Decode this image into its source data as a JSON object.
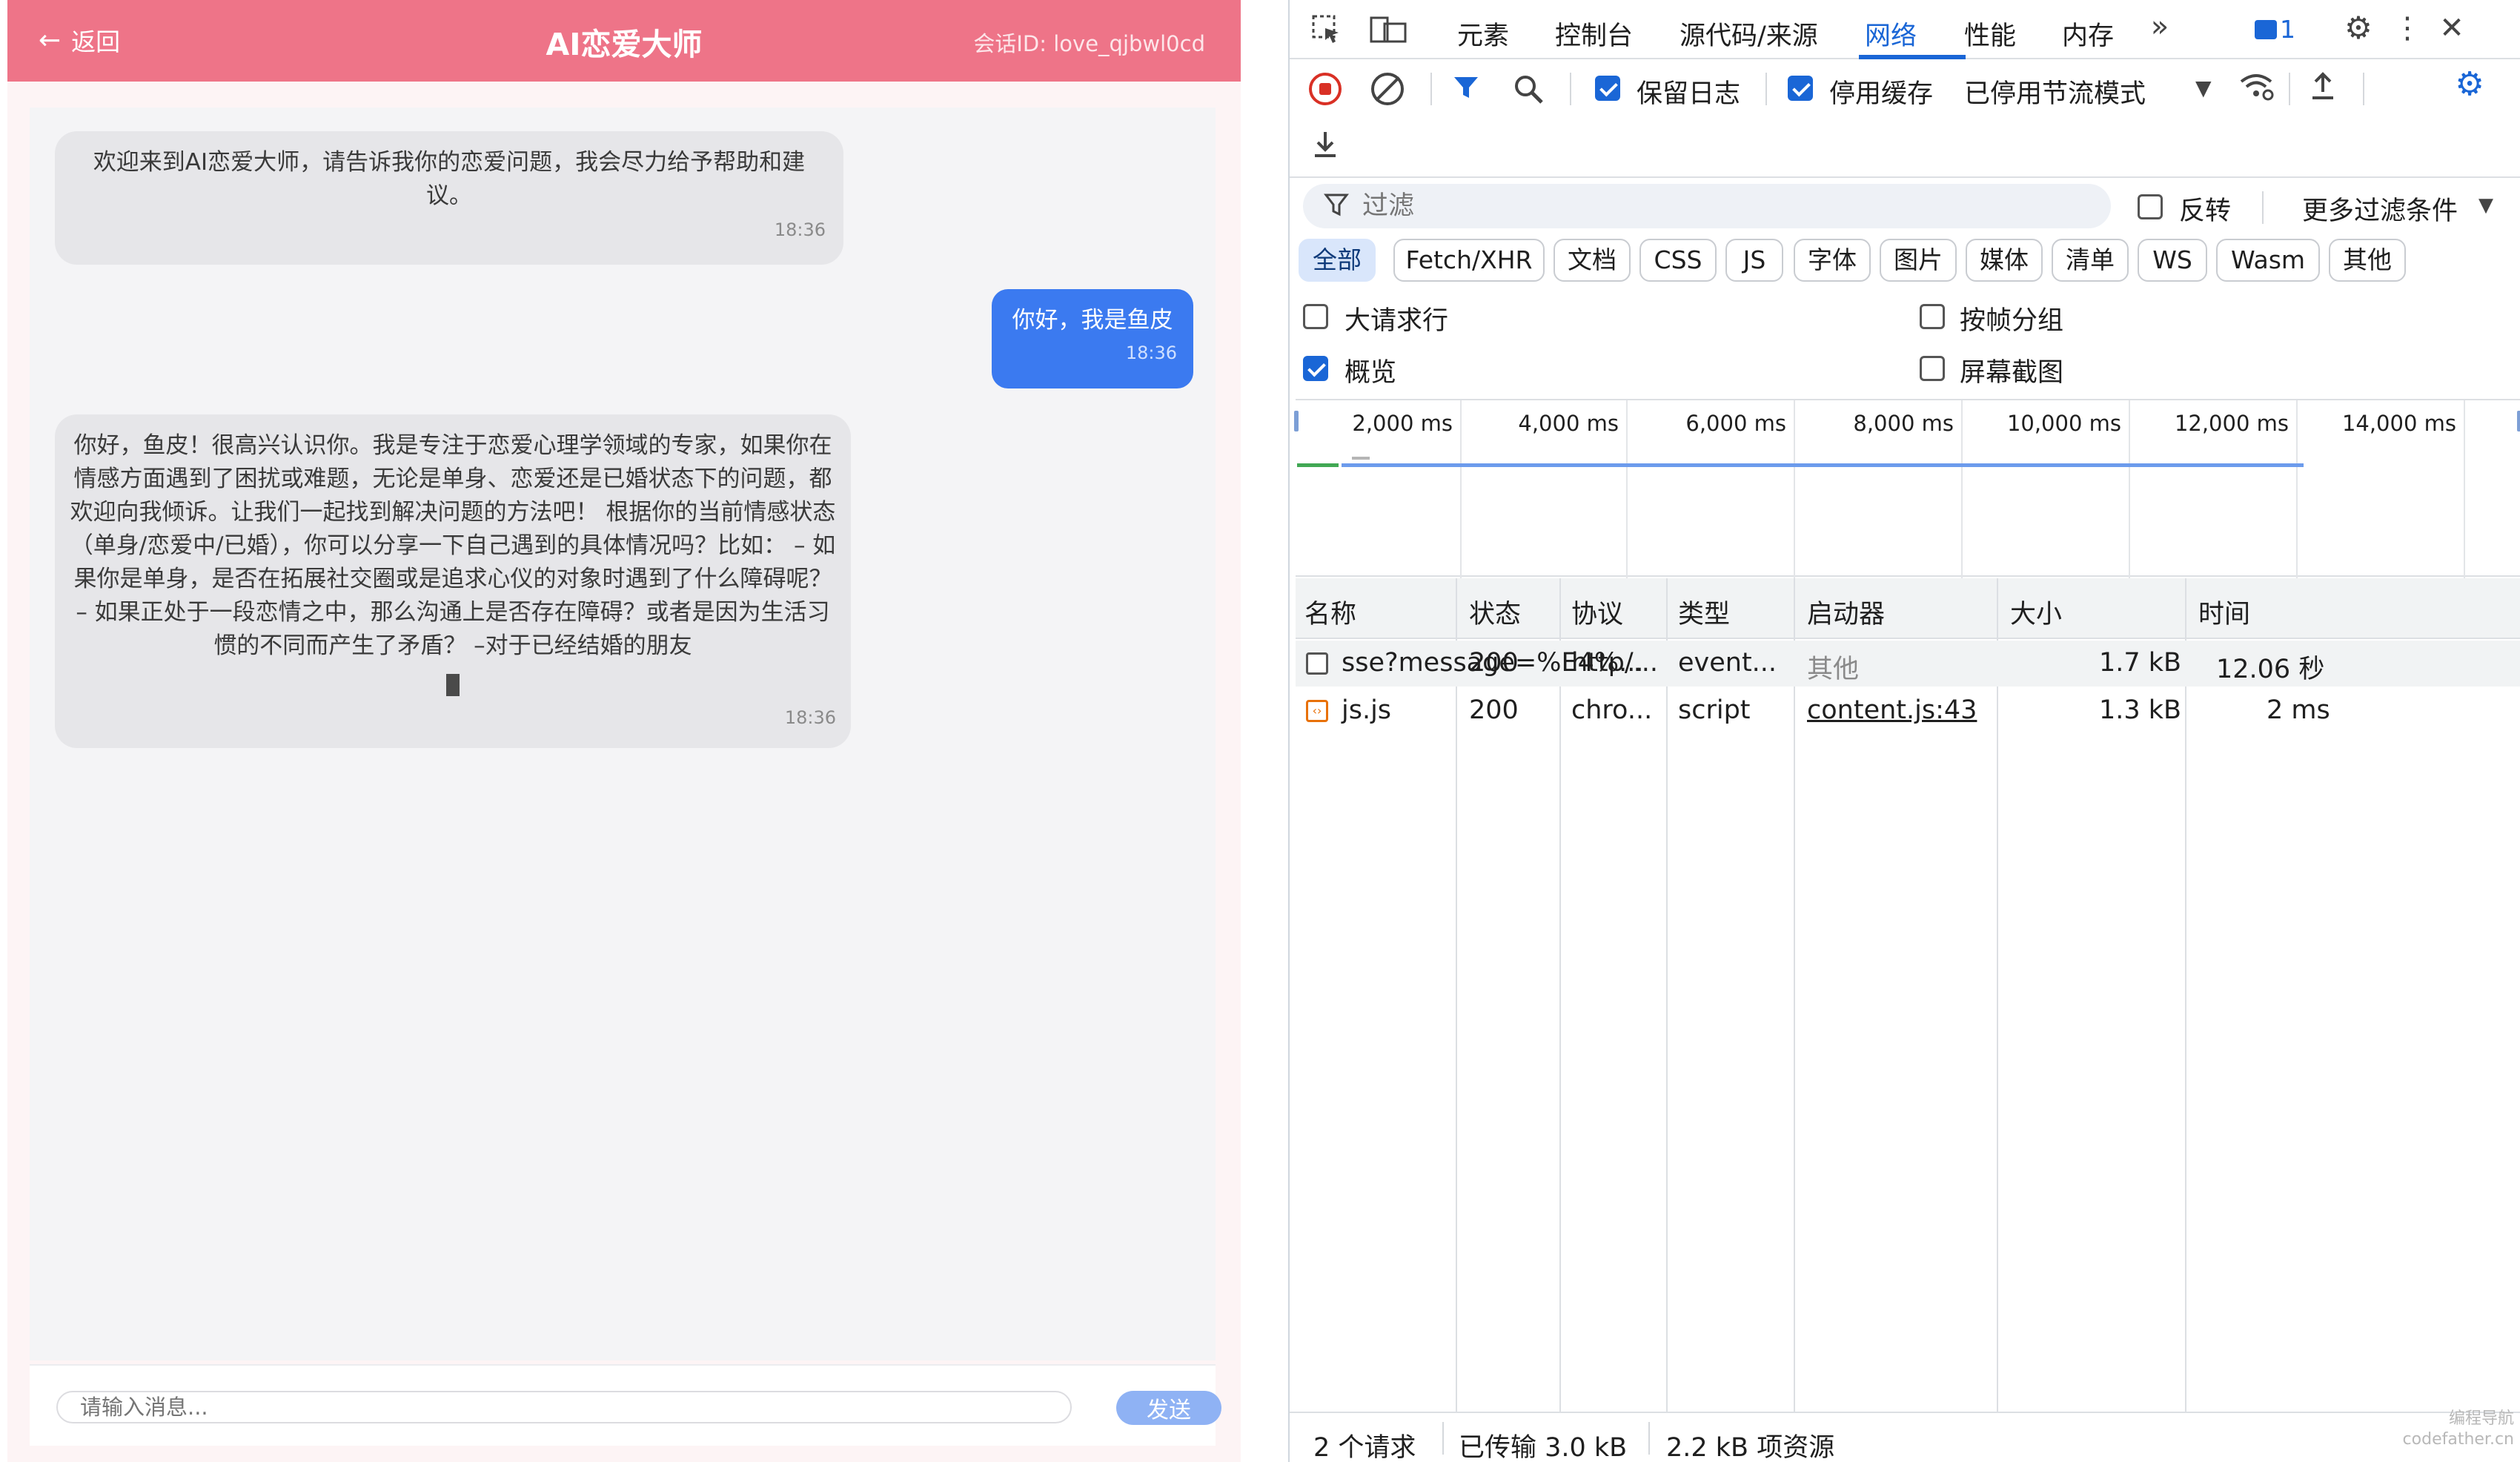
{
  "app": {
    "back_label": "返回",
    "title": "AI恋爱大师",
    "session_id": "会话ID: love_qjbwl0cd",
    "messages": [
      {
        "role": "bot",
        "text": "欢迎来到AI恋爱大师，请告诉我你的恋爱问题，我会尽力给予帮助和建议。",
        "time": "18:36"
      },
      {
        "role": "user",
        "text": "你好，我是鱼皮",
        "time": "18:36"
      },
      {
        "role": "bot",
        "text": "你好，鱼皮！很高兴认识你。我是专注于恋爱心理学领域的专家，如果你在情感方面遇到了困扰或难题，无论是单身、恋爱还是已婚状态下的问题，都欢迎向我倾诉。让我们一起找到解决问题的方法吧！ 根据你的当前情感状态（单身/恋爱中/已婚），你可以分享一下自己遇到的具体情况吗？比如： – 如果你是单身，是否在拓展社交圈或是追求心仪的对象时遇到了什么障碍呢？ – 如果正处于一段恋情之中，那么沟通上是否存在障碍？或者是因为生活习惯的不同而产生了矛盾？ –对于已经结婚的朋友",
        "time": "18:36"
      }
    ],
    "input_placeholder": "请输入消息...",
    "send_label": "发送"
  },
  "devtools": {
    "tabs": [
      "元素",
      "控制台",
      "源代码/来源",
      "网络",
      "性能",
      "内存"
    ],
    "active_tab": "网络",
    "issues_count": "1",
    "toolbar": {
      "preserve_log": "保留日志",
      "disable_cache": "停用缓存",
      "throttle": "已停用节流模式"
    },
    "filter": {
      "placeholder": "过滤",
      "invert": "反转",
      "more_filters": "更多过滤条件"
    },
    "type_chips": [
      "全部",
      "Fetch/XHR",
      "文档",
      "CSS",
      "JS",
      "字体",
      "图片",
      "媒体",
      "清单",
      "WS",
      "Wasm",
      "其他"
    ],
    "options": {
      "big_rows": "大请求行",
      "group_by_frame": "按帧分组",
      "overview": "概览",
      "screenshots": "屏幕截图"
    },
    "timeline_ticks": [
      "2,000 ms",
      "4,000 ms",
      "6,000 ms",
      "8,000 ms",
      "10,000 ms",
      "12,000 ms",
      "14,000 ms"
    ],
    "columns": [
      "名称",
      "状态",
      "协议",
      "类型",
      "启动器",
      "大小",
      "时间"
    ],
    "rows": [
      {
        "name": "sse?message=%E4%...",
        "status": "200",
        "protocol": "http/...",
        "type": "event...",
        "initiator": "其他",
        "size": "1.7 kB",
        "time": "12.06 秒"
      },
      {
        "name": "js.js",
        "status": "200",
        "protocol": "chro...",
        "type": "script",
        "initiator": "content.js:43",
        "size": "1.3 kB",
        "time": "2 ms"
      }
    ],
    "status_bar": {
      "requests": "2 个请求",
      "transferred": "已传输 3.0 kB",
      "resources": "2.2 kB 项资源"
    }
  },
  "watermark": [
    "编程导航",
    "codefather.cn"
  ],
  "colors": {
    "header_pink": "#ee7488",
    "user_bubble": "#3b7af0",
    "devtools_accent": "#1a66d6"
  }
}
